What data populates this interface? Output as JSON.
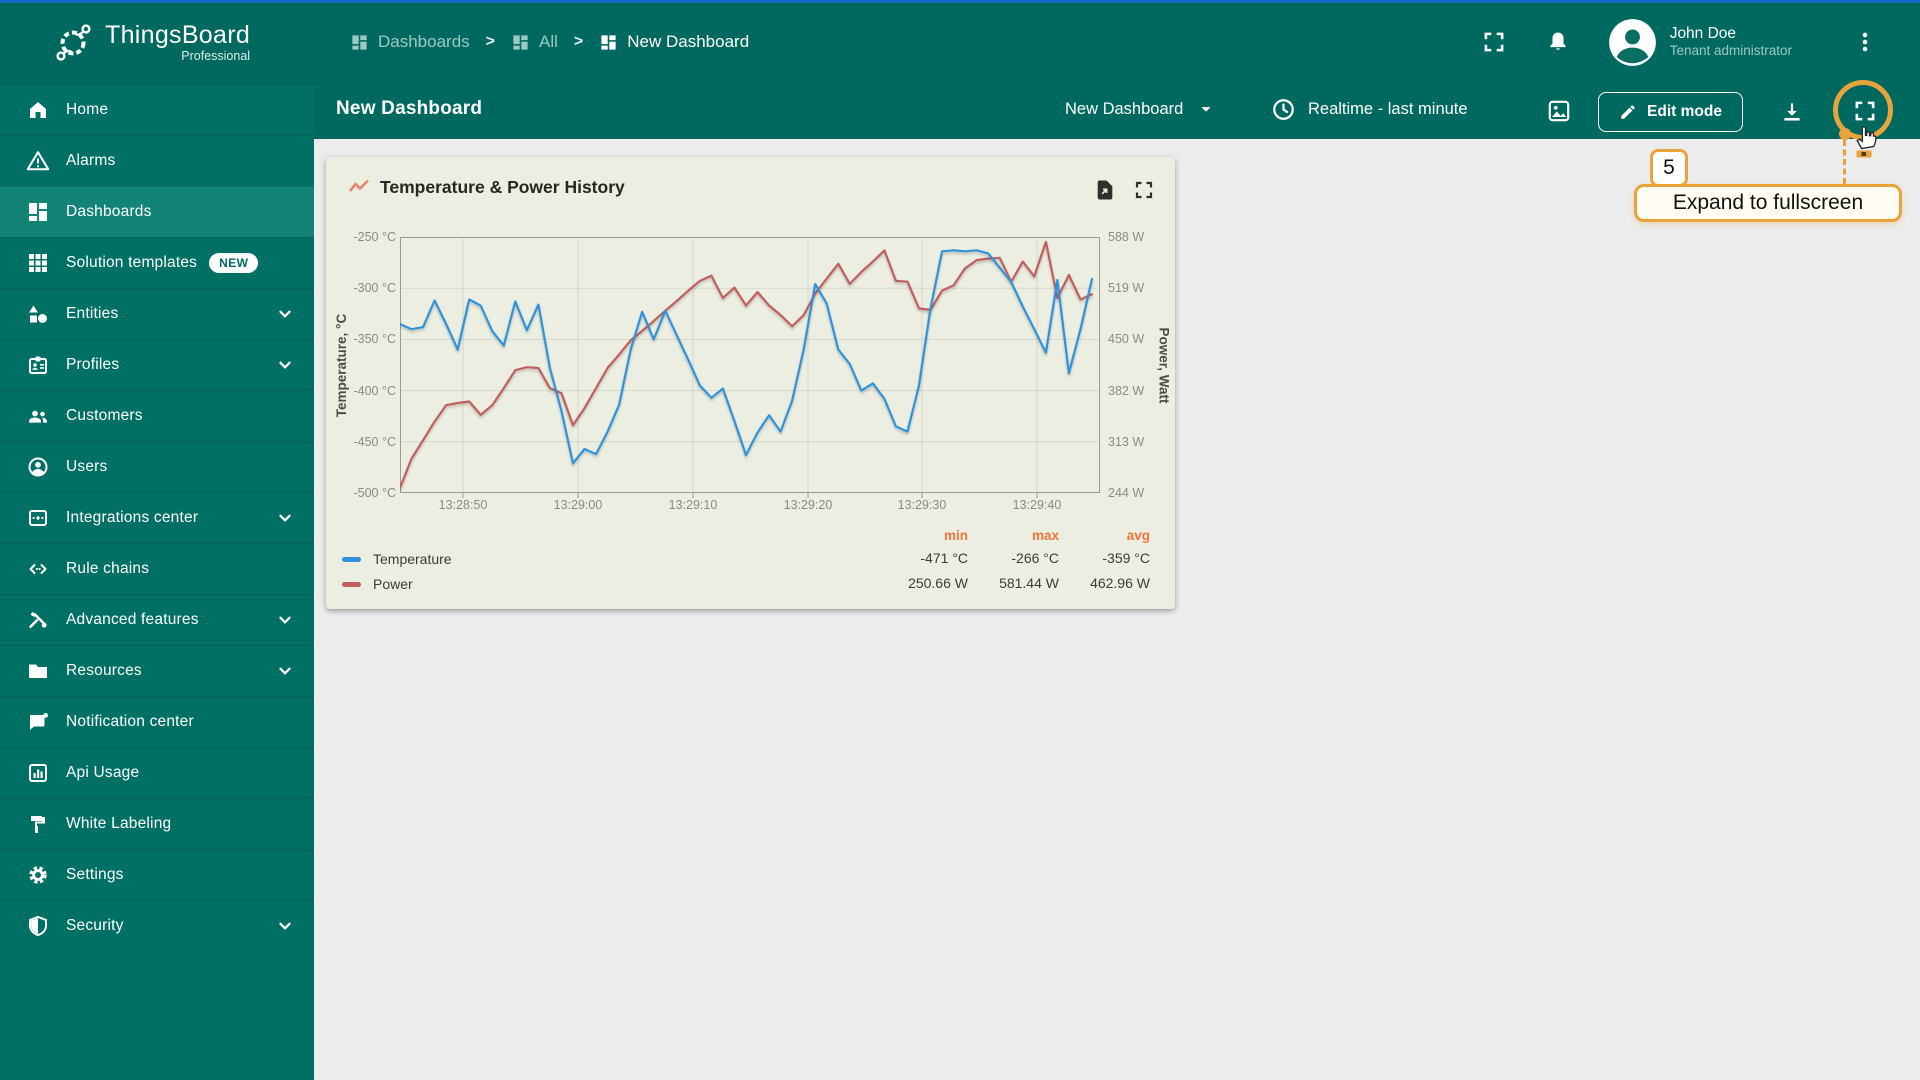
{
  "app": {
    "brand": "ThingsBoard",
    "brand_sub": "Professional"
  },
  "colors": {
    "header_teal": "#00695f",
    "sidebar_teal": "#007065",
    "selected_teal": "#128377",
    "widget_bg": "#ECEEE1",
    "annotation_gold": "#E9A33B",
    "legend_stat_header": "#F2743C",
    "temperature_line": "#2E93DB",
    "power_line": "#C05F5E"
  },
  "sidebar": {
    "items": [
      {
        "icon": "home-icon",
        "label": "Home"
      },
      {
        "icon": "alarms-icon",
        "label": "Alarms"
      },
      {
        "icon": "dashboards-icon",
        "label": "Dashboards",
        "selected": true
      },
      {
        "icon": "solution-templates-icon",
        "label": "Solution templates",
        "badge": "NEW"
      },
      {
        "icon": "entities-icon",
        "label": "Entities",
        "expandable": true
      },
      {
        "icon": "profiles-icon",
        "label": "Profiles",
        "expandable": true
      },
      {
        "icon": "customers-icon",
        "label": "Customers"
      },
      {
        "icon": "users-icon",
        "label": "Users"
      },
      {
        "icon": "integrations-icon",
        "label": "Integrations center",
        "expandable": true
      },
      {
        "icon": "rule-chains-icon",
        "label": "Rule chains"
      },
      {
        "icon": "advanced-features-icon",
        "label": "Advanced features",
        "expandable": true
      },
      {
        "icon": "resources-icon",
        "label": "Resources",
        "expandable": true
      },
      {
        "icon": "notification-center-icon",
        "label": "Notification center"
      },
      {
        "icon": "api-usage-icon",
        "label": "Api Usage"
      },
      {
        "icon": "white-labeling-icon",
        "label": "White Labeling"
      },
      {
        "icon": "settings-icon",
        "label": "Settings"
      },
      {
        "icon": "security-icon",
        "label": "Security",
        "expandable": true
      }
    ]
  },
  "topbar": {
    "breadcrumbs": [
      {
        "label": "Dashboards"
      },
      {
        "label": "All"
      },
      {
        "label": "New Dashboard"
      }
    ],
    "user": {
      "name": "John Doe",
      "role": "Tenant administrator"
    }
  },
  "toolbar": {
    "title": "New Dashboard",
    "dashboard_select": "New Dashboard",
    "realtime": "Realtime - last minute",
    "edit_mode_label": "Edit mode"
  },
  "annotation": {
    "step": "5",
    "tooltip": "Expand to fullscreen"
  },
  "widget": {
    "title": "Temperature & Power History"
  },
  "chart_data": {
    "type": "line",
    "title": "Temperature & Power History",
    "x_start": "13:28:45",
    "x_end": "13:29:45",
    "x_interval_seconds": 1,
    "x_ticks": [
      "13:28:50",
      "13:29:00",
      "13:29:10",
      "13:29:20",
      "13:29:30",
      "13:29:40"
    ],
    "grid": true,
    "legend_position": "bottom",
    "legend_headers": [
      "min",
      "max",
      "avg"
    ],
    "left_axis": {
      "label": "Temperature, °C",
      "min": -500,
      "max": -250,
      "ticks": [
        "-250 °C",
        "-300 °C",
        "-350 °C",
        "-400 °C",
        "-450 °C",
        "-500 °C"
      ]
    },
    "right_axis": {
      "label": "Power, Watt",
      "min": 244,
      "max": 588,
      "ticks": [
        "588 W",
        "519 W",
        "450 W",
        "382 W",
        "313 W",
        "244 W"
      ]
    },
    "series": [
      {
        "name": "Power",
        "axis": "right",
        "color": "#C05F5E",
        "unit": "W",
        "min": "250.66 W",
        "max": "581.44 W",
        "avg": "462.96 W",
        "values": [
          250.66,
          290,
          315,
          340,
          362,
          365,
          367,
          349,
          362,
          385,
          409,
          413,
          412,
          385,
          378,
          335,
          358,
          385,
          412,
          430,
          449,
          462,
          475,
          489,
          502,
          516,
          529,
          536,
          506,
          520,
          496,
          514,
          496,
          483,
          468,
          483,
          512,
          532,
          552,
          525,
          541,
          555,
          570,
          529,
          528,
          492,
          490,
          516,
          523,
          546,
          557,
          559,
          560,
          528,
          555,
          535,
          581.44,
          506,
          537,
          504,
          511
        ]
      },
      {
        "name": "Temperature",
        "axis": "left",
        "color": "#2E93DB",
        "unit": "°C",
        "min": "-471 °C",
        "max": "-266 °C",
        "avg": "-359 °C",
        "values": [
          -335,
          -340,
          -338,
          -312,
          -335,
          -360,
          -311,
          -317,
          -342,
          -356,
          -313,
          -341,
          -316,
          -378,
          -420,
          -471,
          -457,
          -462,
          -440,
          -414,
          -360,
          -323,
          -350,
          -322,
          -346,
          -370,
          -395,
          -407,
          -398,
          -430,
          -463,
          -441,
          -424,
          -440,
          -410,
          -360,
          -296,
          -315,
          -360,
          -374,
          -400,
          -393,
          -408,
          -435,
          -440,
          -395,
          -320,
          -264,
          -263,
          -264,
          -263,
          -266,
          -280,
          -294,
          -318,
          -340,
          -363,
          -292,
          -383,
          -340,
          -291
        ]
      }
    ],
    "legend_rows": [
      {
        "name": "Temperature",
        "color": "#2E93DB",
        "min": "-471 °C",
        "max": "-266 °C",
        "avg": "-359 °C"
      },
      {
        "name": "Power",
        "color": "#C05F5E",
        "min": "250.66 W",
        "max": "581.44 W",
        "avg": "462.96 W"
      }
    ]
  }
}
